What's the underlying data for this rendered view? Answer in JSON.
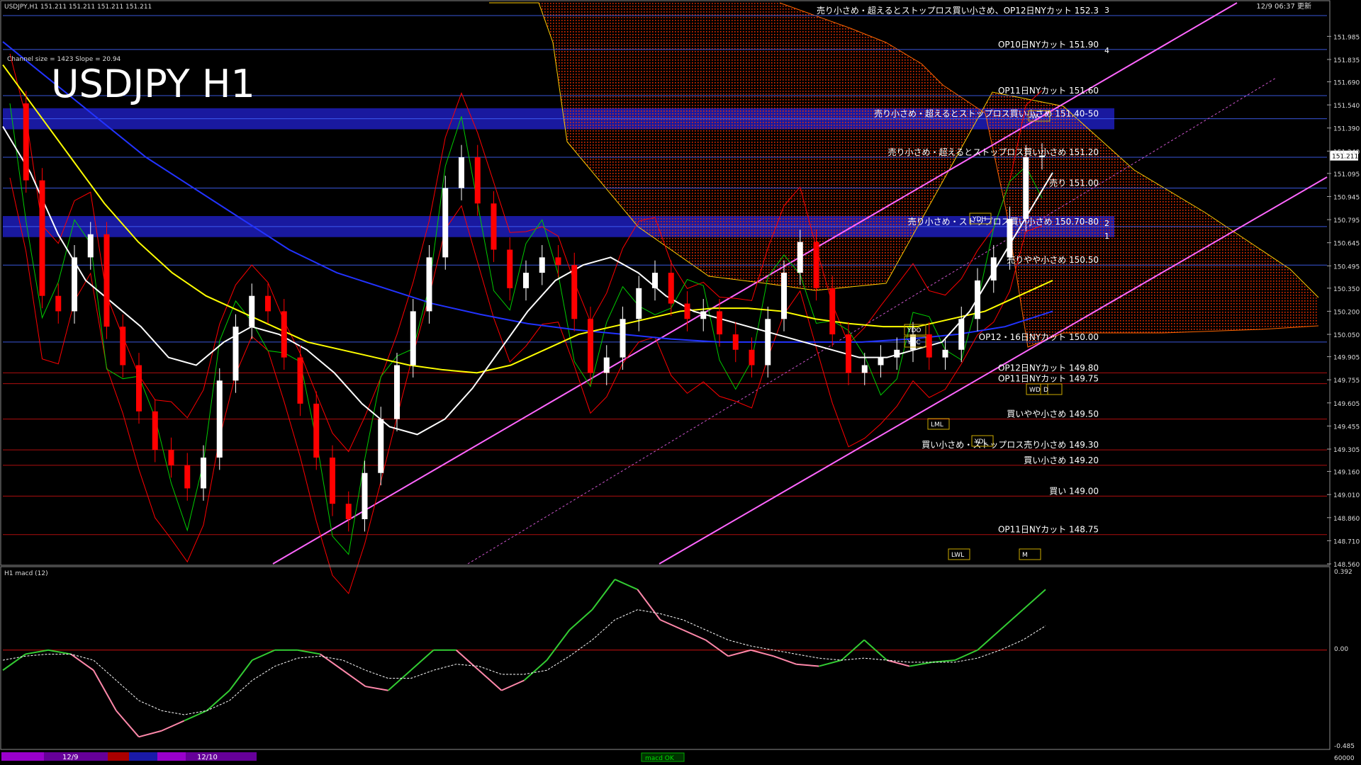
{
  "header": {
    "symbol_line": "USDJPY,H1  151.211 151.211 151.211 151.211",
    "timestamp": "12/9 06:37 更新",
    "channel_info": "Channel size = 1423 Slope = 20.94",
    "big_title": "USDJPY H1"
  },
  "colors": {
    "background": "#000000",
    "bull_candle": "#ffffff",
    "bear_candle": "#ff0000",
    "ichimoku_cloud": "#ff3300",
    "zone_band": "#1a1aa8",
    "channel": "#ff66ff",
    "ma_fast": "#ffffff",
    "ma_mid": "#ffff00",
    "ma_slow": "#2233ff",
    "bollinger": "#ff0000",
    "chikou": "#00cc00",
    "macd_line": "#33cc33",
    "macd_line_neg": "#ff88aa",
    "macd_signal": "#ffffff"
  },
  "level_annotations": [
    {
      "text": "売り小さめ・超えるとストップロス買い小さめ、OP12日NYカット 152.3",
      "price": 152.12
    },
    {
      "text": "OP10日NYカット 151.90",
      "price": 151.9
    },
    {
      "text": "OP11日NYカット 151.60",
      "price": 151.6
    },
    {
      "text": "売り小さめ・超えるとストップロス買い小さめ 151.40-50",
      "price": 151.45
    },
    {
      "text": "売り小さめ・超えるとストップロス買い小さめ 151.20",
      "price": 151.2
    },
    {
      "text": "売り 151.00",
      "price": 151.0
    },
    {
      "text": "売り小さめ・ストップロス買い小さめ 150.70-80",
      "price": 150.75
    },
    {
      "text": "売りやや小さめ 150.50",
      "price": 150.5
    },
    {
      "text": "OP12・16日NYカット 150.00",
      "price": 150.0
    },
    {
      "text": "OP12日NYカット 149.80",
      "price": 149.8
    },
    {
      "text": "OP11日NYカット 149.75",
      "price": 149.73
    },
    {
      "text": "買いやや小さめ 149.50",
      "price": 149.5
    },
    {
      "text": "買い小さめ・ストップロス売り小さめ 149.30",
      "price": 149.3
    },
    {
      "text": "買い小さめ 149.20",
      "price": 149.2
    },
    {
      "text": "買い 149.00",
      "price": 149.0
    },
    {
      "text": "OP11日NYカット 148.75",
      "price": 148.75
    }
  ],
  "box_labels": [
    "YDH",
    "YDO",
    "YDC",
    "YDL",
    "LML",
    "LWL",
    "WD",
    "D",
    "W",
    "M"
  ],
  "fib_labels": [
    "1",
    "2",
    "3",
    "4"
  ],
  "macd_panel": {
    "title": "H1 macd (12)",
    "ticks": [
      "0.392",
      "0.00",
      "-0.485"
    ],
    "bottom_tick": "60000",
    "status": "macd OK"
  },
  "date_labels": [
    "12/9",
    "12/10"
  ],
  "chart_data": [
    {
      "type": "candlestick",
      "title": "USDJPY H1",
      "ylim": [
        148.56,
        152.12
      ],
      "y_ticks": [
        "151.985",
        "151.835",
        "151.690",
        "151.540",
        "151.390",
        "151.240",
        "151.095",
        "150.945",
        "150.795",
        "150.645",
        "150.495",
        "150.350",
        "150.200",
        "150.050",
        "149.905",
        "149.755",
        "149.605",
        "149.455",
        "149.305",
        "149.160",
        "149.010",
        "148.860",
        "148.710",
        "148.560"
      ],
      "current_price": "151.211",
      "zones": [
        [
          151.4,
          151.5
        ],
        [
          150.7,
          150.8
        ]
      ],
      "price_path": [
        151.55,
        151.05,
        150.3,
        150.2,
        150.55,
        150.7,
        150.1,
        149.85,
        149.55,
        149.3,
        149.2,
        149.05,
        149.25,
        149.75,
        150.1,
        150.3,
        150.2,
        149.9,
        149.6,
        149.25,
        148.95,
        148.85,
        149.15,
        149.5,
        149.85,
        150.2,
        150.55,
        151.0,
        151.2,
        150.9,
        150.6,
        150.35,
        150.45,
        150.55,
        150.5,
        150.15,
        149.8,
        149.9,
        150.15,
        150.35,
        150.45,
        150.25,
        150.15,
        150.2,
        150.05,
        149.95,
        149.85,
        150.15,
        150.45,
        150.65,
        150.35,
        150.05,
        149.8,
        149.85,
        149.9,
        149.95,
        150.05,
        149.9,
        149.95,
        150.15,
        150.4,
        150.55,
        150.8,
        151.2,
        151.211
      ],
      "ma_fast": [
        151.4,
        151.1,
        150.7,
        150.4,
        150.25,
        150.1,
        149.9,
        149.85,
        150.0,
        150.1,
        150.05,
        149.95,
        149.8,
        149.6,
        149.45,
        149.4,
        149.5,
        149.7,
        149.95,
        150.2,
        150.4,
        150.5,
        150.55,
        150.45,
        150.3,
        150.2,
        150.15,
        150.1,
        150.05,
        150.0,
        149.95,
        149.9,
        149.9,
        149.95,
        150.0,
        150.2,
        150.5,
        150.8,
        151.1
      ],
      "ma_mid": [
        151.8,
        151.5,
        151.2,
        150.9,
        150.65,
        150.45,
        150.3,
        150.2,
        150.1,
        150.0,
        149.95,
        149.9,
        149.85,
        149.82,
        149.8,
        149.85,
        149.95,
        150.05,
        150.1,
        150.15,
        150.2,
        150.22,
        150.22,
        150.2,
        150.15,
        150.12,
        150.1,
        150.1,
        150.15,
        150.2,
        150.3,
        150.4
      ],
      "ma_slow": [
        151.95,
        151.7,
        151.45,
        151.2,
        151.0,
        150.8,
        150.6,
        150.45,
        150.35,
        150.25,
        150.18,
        150.12,
        150.08,
        150.05,
        150.02,
        150.0,
        150.0,
        150.0,
        150.0,
        150.02,
        150.05,
        150.1,
        150.2
      ],
      "macd": [
        -0.1,
        -0.02,
        0.0,
        -0.02,
        -0.1,
        -0.3,
        -0.43,
        -0.4,
        -0.35,
        -0.3,
        -0.2,
        -0.05,
        0.0,
        0.0,
        -0.02,
        -0.1,
        -0.18,
        -0.2,
        -0.1,
        0.0,
        0.0,
        -0.1,
        -0.2,
        -0.15,
        -0.05,
        0.1,
        0.2,
        0.35,
        0.3,
        0.15,
        0.1,
        0.05,
        -0.03,
        0.0,
        -0.03,
        -0.07,
        -0.08,
        -0.05,
        0.05,
        -0.05,
        -0.08,
        -0.06,
        -0.05,
        0.0,
        0.1,
        0.2,
        0.3
      ],
      "macd_signal": [
        -0.05,
        -0.03,
        -0.02,
        -0.02,
        -0.05,
        -0.15,
        -0.25,
        -0.3,
        -0.32,
        -0.3,
        -0.25,
        -0.15,
        -0.08,
        -0.04,
        -0.03,
        -0.05,
        -0.1,
        -0.14,
        -0.14,
        -0.1,
        -0.07,
        -0.08,
        -0.12,
        -0.12,
        -0.1,
        -0.03,
        0.05,
        0.15,
        0.2,
        0.18,
        0.15,
        0.1,
        0.05,
        0.02,
        0.0,
        -0.02,
        -0.04,
        -0.05,
        -0.04,
        -0.05,
        -0.06,
        -0.06,
        -0.06,
        -0.04,
        0.0,
        0.05,
        0.12
      ]
    }
  ]
}
